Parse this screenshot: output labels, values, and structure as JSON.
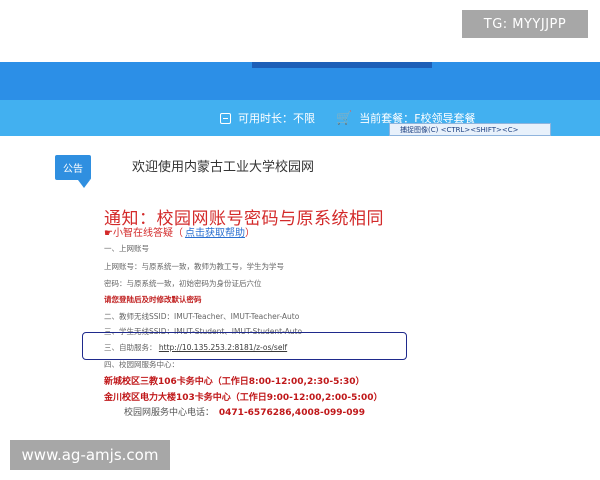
{
  "watermark_top": "TG: MYYJJPP",
  "watermark_bottom": "www.ag-amjs.com",
  "status_bar": {
    "duration_label": "可用时长：",
    "duration_value": "不限",
    "package_label": "当前套餐：",
    "package_value": "F校领导套餐"
  },
  "tooltip": "捕捉图像(C)   <CTRL><SHIFT><C>",
  "notice": {
    "badge": "公告",
    "welcome": "欢迎使用内蒙古工业大学校园网"
  },
  "document": {
    "title": "通知：校园网账号密码与原系统相同",
    "hint_prefix": "☛小智在线答疑（",
    "hint_link": "点击获取帮助",
    "hint_suffix": "）",
    "lines": [
      "一、上网账号",
      "上网账号：与原系统一致，教师为教工号，学生为学号",
      "密码：与原系统一致，初始密码为身份证后六位"
    ],
    "warning": "请您登陆后及时修改默认密码",
    "ssid_teacher": "二、教师无线SSID：IMUT-Teacher、IMUT-Teacher-Auto",
    "ssid_student": "三、学生无线SSID：IMUT-Student、IMUT-Student-Auto",
    "self_service_label": "三、自助服务：",
    "self_service_url": "http://10.135.253.2:8181/z-os/self",
    "service_center": "四、校园网服务中心：",
    "campus_new": "新城校区三教106卡务中心（工作日8:00-12:00,2:30-5:30）",
    "campus_jinchuan": "金川校区电力大楼103卡务中心（工作日9:00-12:00,2:00-5:00）",
    "hotline_label": "校园网服务中心电话：",
    "hotline_number": "0471-6576286,4008-099-099"
  }
}
